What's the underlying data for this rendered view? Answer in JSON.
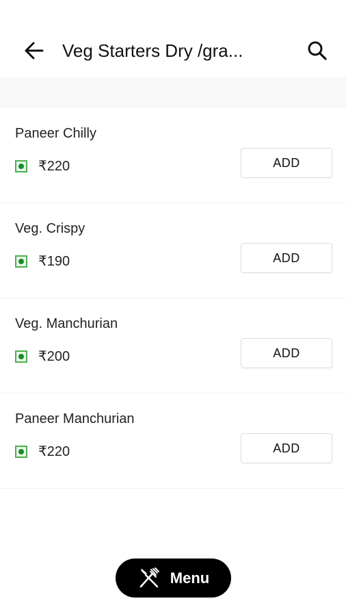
{
  "header": {
    "title": "Veg Starters Dry /gra...",
    "back_icon": "arrow-left-icon",
    "search_icon": "search-icon"
  },
  "items": [
    {
      "name": "Paneer Chilly",
      "price": "₹220",
      "add_label": "ADD"
    },
    {
      "name": "Veg. Crispy",
      "price": "₹190",
      "add_label": "ADD"
    },
    {
      "name": "Veg. Manchurian",
      "price": "₹200",
      "add_label": "ADD"
    },
    {
      "name": "Paneer Manchurian",
      "price": "₹220",
      "add_label": "ADD"
    }
  ],
  "menu_button": {
    "label": "Menu",
    "icon": "fork-knife-icon"
  },
  "colors": {
    "veg_indicator": "#1b8a2a",
    "menu_button_bg": "#000000"
  }
}
